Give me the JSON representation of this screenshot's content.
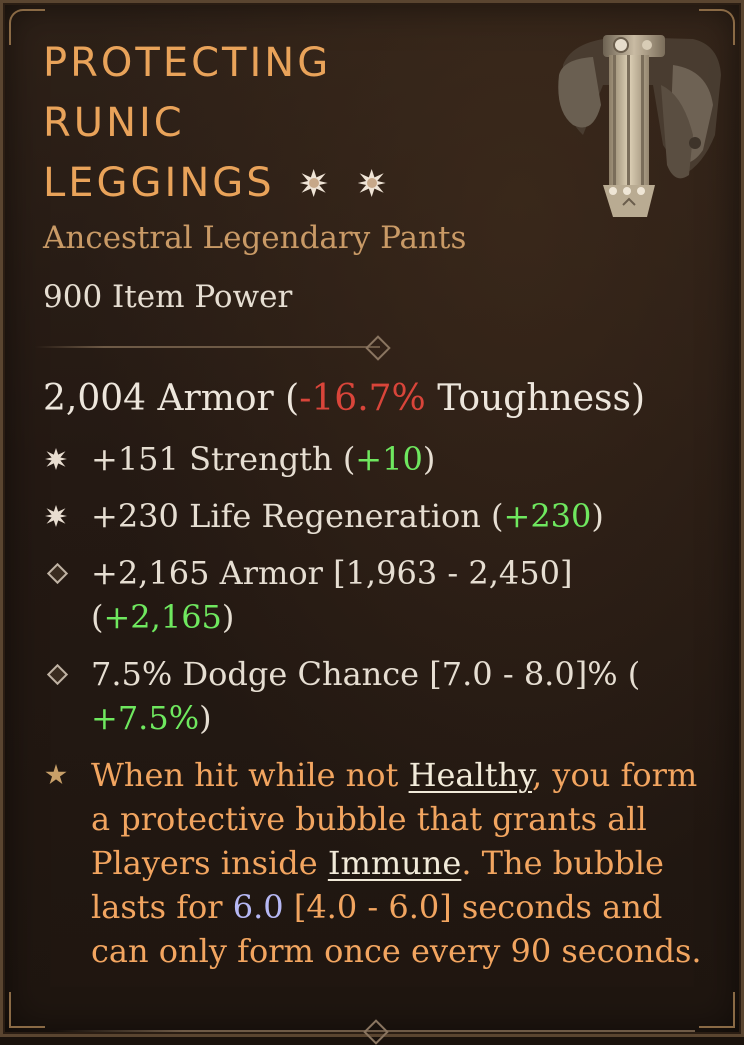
{
  "item": {
    "title_lines": [
      "PROTECTING",
      "RUNIC",
      "LEGGINGS"
    ],
    "socket_icons": [
      "socket-gem-icon",
      "socket-gem-icon"
    ],
    "type": "Ancestral Legendary Pants",
    "power": "900 Item Power"
  },
  "armor": {
    "value": "2,004 Armor",
    "open": " (",
    "toughness_delta": "-16.7%",
    "toughness_label": " Toughness)"
  },
  "affixes": [
    {
      "icon": "starburst-icon",
      "text": "+151 Strength ",
      "open": "(",
      "delta": "+10",
      "close": ")"
    },
    {
      "icon": "starburst-icon",
      "text": "+230 Life Regeneration ",
      "open": "(",
      "delta": "+230",
      "close": ")"
    },
    {
      "icon": "diamond-icon",
      "text": "+2,165 Armor [1,963 - 2,450] ",
      "open": "(",
      "delta": "+2,165",
      "close": ")"
    },
    {
      "icon": "diamond-icon",
      "text": "7.5% Dodge Chance [7.0 - 8.0]% ",
      "open": "(",
      "delta": "+7.5%",
      "close": ")"
    }
  ],
  "legendary": {
    "icon": "star-icon",
    "p1": "When hit while not ",
    "kw1": "Healthy",
    "p2": ", you form a protective bubble that grants all Players inside ",
    "kw2": "Immune",
    "p3": ". The bubble lasts for ",
    "value": "6.0",
    "p4": " [4.0 - 6.0] seconds and can only form once every 90 seconds."
  },
  "colors": {
    "title": "#e9a35a",
    "legendary_text": "#f2a560",
    "negative": "#d9453a",
    "positive": "#6fe85f",
    "value_blue": "#b6b8f4"
  }
}
